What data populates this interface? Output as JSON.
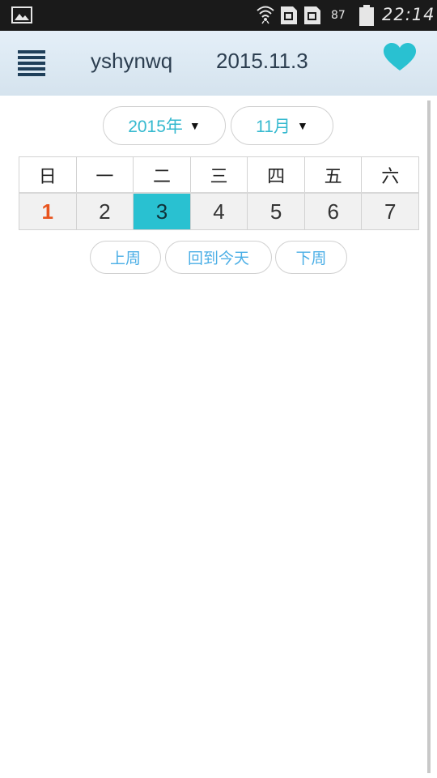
{
  "status_bar": {
    "battery_percent": "87",
    "time": "22:14"
  },
  "header": {
    "username": "yshynwq",
    "date": "2015.11.3"
  },
  "selectors": {
    "year": "2015年",
    "month": "11月"
  },
  "week": {
    "weekdays": [
      "日",
      "一",
      "二",
      "三",
      "四",
      "五",
      "六"
    ],
    "days": [
      "1",
      "2",
      "3",
      "4",
      "5",
      "6",
      "7"
    ],
    "selected_day": "3"
  },
  "nav": {
    "prev_week": "上周",
    "today": "回到今天",
    "next_week": "下周"
  },
  "colors": {
    "accent": "#29c1d1",
    "sunday": "#e8541e",
    "link": "#4aaee6"
  },
  "icons": {
    "menu": "hamburger-menu-icon",
    "favorite": "heart-icon"
  }
}
